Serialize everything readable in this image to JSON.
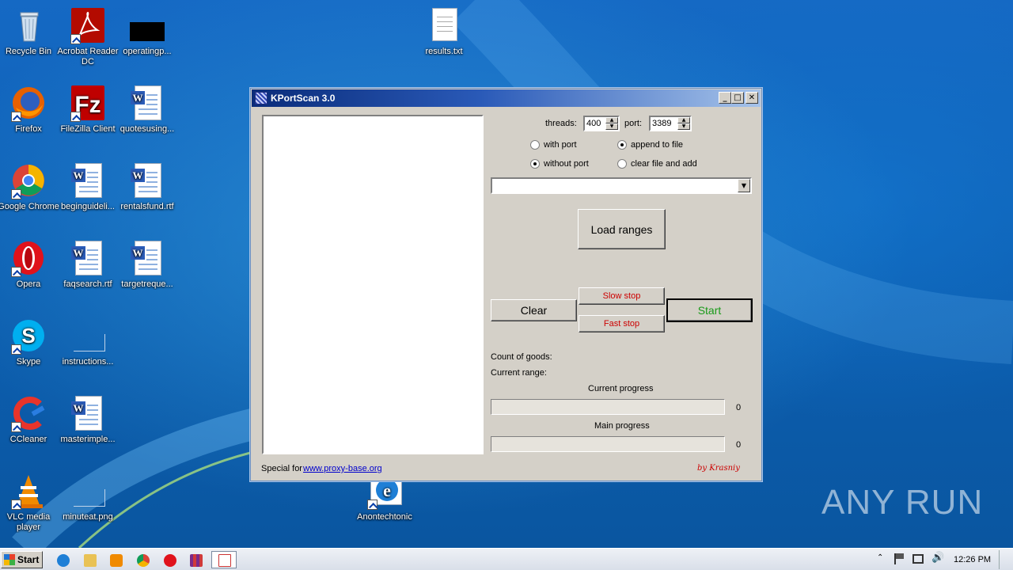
{
  "desktop": {
    "icons": {
      "recycle_bin": "Recycle Bin",
      "acrobat": "Acrobat Reader DC",
      "operatingp": "operatingp...",
      "results": "results.txt",
      "firefox": "Firefox",
      "filezilla": "FileZilla Client",
      "quotesusing": "quotesusing...",
      "chrome": "Google Chrome",
      "beginguide": "beginguideli...",
      "rentalsfund": "rentalsfund.rtf",
      "opera": "Opera",
      "faqsearch": "faqsearch.rtf",
      "targetreque": "targetreque...",
      "skype": "Skype",
      "instructions": "instructions...",
      "ccleaner": "CCleaner",
      "masterimple": "masterimple...",
      "vlc": "VLC media player",
      "minuteat": "minuteat.png",
      "anontech": "Anontechtonic"
    },
    "watermark": "ANY RUN"
  },
  "window": {
    "title": "KPortScan 3.0",
    "threads_label": "threads:",
    "threads_value": "400",
    "port_label": "port:",
    "port_value": "3389",
    "radio_with_port": "with port",
    "radio_without_port": "without port",
    "radio_append": "append to file",
    "radio_clear": "clear file and add",
    "load_ranges": "Load ranges",
    "clear_btn": "Clear",
    "slow_stop": "Slow stop",
    "fast_stop": "Fast stop",
    "start_btn": "Start",
    "count_goods": "Count of goods:",
    "current_range": "Current range:",
    "current_progress": "Current progress",
    "current_progress_value": "0",
    "main_progress": "Main progress",
    "main_progress_value": "0",
    "special_for": "Special for",
    "special_link": "www.proxy-base.org",
    "by_author": "by Krasniy",
    "colors": {
      "stop_red": "#cc0000",
      "start_green": "#1a9a1a",
      "link_blue": "#0000cc"
    }
  },
  "taskbar": {
    "start": "Start",
    "clock": "12:26 PM"
  }
}
